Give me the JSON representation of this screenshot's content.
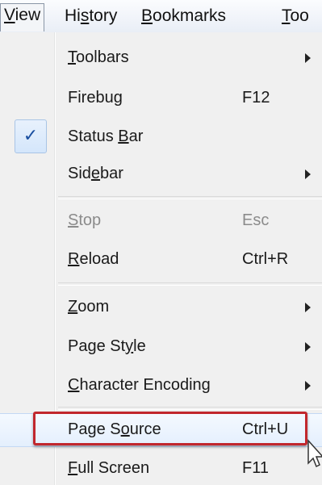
{
  "menubar": {
    "items": [
      {
        "pre": "",
        "mn": "V",
        "post": "iew"
      },
      {
        "pre": "Hi",
        "mn": "s",
        "post": "tory"
      },
      {
        "pre": "",
        "mn": "B",
        "post": "ookmarks"
      },
      {
        "pre": "",
        "mn": "T",
        "post": "oo"
      }
    ]
  },
  "menu": {
    "toolbars": {
      "pre": "",
      "mn": "T",
      "post": "oolbars"
    },
    "firebug": {
      "label": "Firebug",
      "shortcut": "F12"
    },
    "status_bar": {
      "pre": "Status ",
      "mn": "B",
      "post": "ar",
      "checked": "✓"
    },
    "sidebar": {
      "pre": "Sid",
      "mn": "e",
      "post": "bar"
    },
    "stop": {
      "pre": "",
      "mn": "S",
      "post": "top",
      "shortcut": "Esc"
    },
    "reload": {
      "pre": "",
      "mn": "R",
      "post": "eload",
      "shortcut": "Ctrl+R"
    },
    "zoom": {
      "pre": "",
      "mn": "Z",
      "post": "oom"
    },
    "page_style": {
      "pre": "Page St",
      "mn": "y",
      "post": "le"
    },
    "character_encoding": {
      "pre": "",
      "mn": "C",
      "post": "haracter Encoding"
    },
    "page_source": {
      "pre": "Page S",
      "mn": "o",
      "post": "urce",
      "shortcut": "Ctrl+U"
    },
    "full_screen": {
      "pre": "",
      "mn": "F",
      "post": "ull Screen",
      "shortcut": "F11"
    }
  },
  "colors": {
    "callout": "#c1272d",
    "check": "#1a4fa0",
    "menu_bg": "#f0f0f0"
  }
}
